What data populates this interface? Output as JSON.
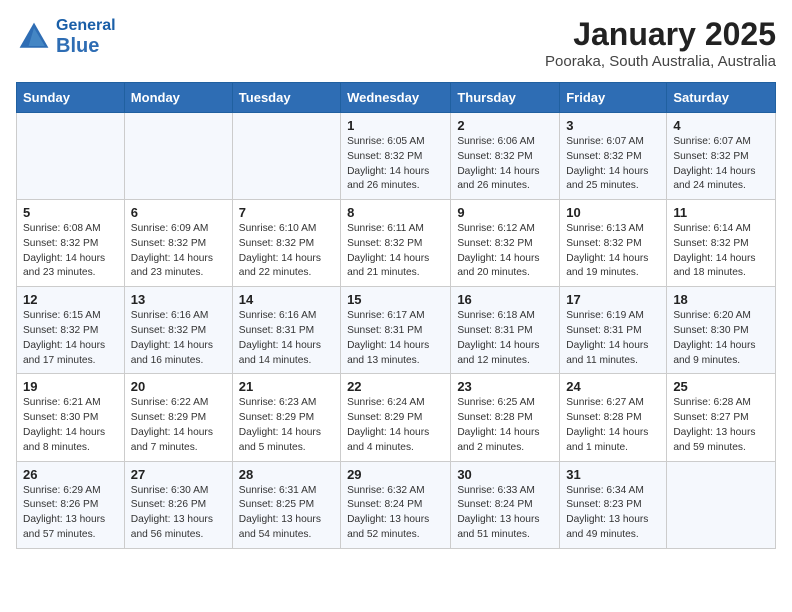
{
  "header": {
    "logo_general": "General",
    "logo_blue": "Blue",
    "title": "January 2025",
    "subtitle": "Pooraka, South Australia, Australia"
  },
  "weekdays": [
    "Sunday",
    "Monday",
    "Tuesday",
    "Wednesday",
    "Thursday",
    "Friday",
    "Saturday"
  ],
  "weeks": [
    [
      {
        "day": "",
        "info": ""
      },
      {
        "day": "",
        "info": ""
      },
      {
        "day": "",
        "info": ""
      },
      {
        "day": "1",
        "info": "Sunrise: 6:05 AM\nSunset: 8:32 PM\nDaylight: 14 hours\nand 26 minutes."
      },
      {
        "day": "2",
        "info": "Sunrise: 6:06 AM\nSunset: 8:32 PM\nDaylight: 14 hours\nand 26 minutes."
      },
      {
        "day": "3",
        "info": "Sunrise: 6:07 AM\nSunset: 8:32 PM\nDaylight: 14 hours\nand 25 minutes."
      },
      {
        "day": "4",
        "info": "Sunrise: 6:07 AM\nSunset: 8:32 PM\nDaylight: 14 hours\nand 24 minutes."
      }
    ],
    [
      {
        "day": "5",
        "info": "Sunrise: 6:08 AM\nSunset: 8:32 PM\nDaylight: 14 hours\nand 23 minutes."
      },
      {
        "day": "6",
        "info": "Sunrise: 6:09 AM\nSunset: 8:32 PM\nDaylight: 14 hours\nand 23 minutes."
      },
      {
        "day": "7",
        "info": "Sunrise: 6:10 AM\nSunset: 8:32 PM\nDaylight: 14 hours\nand 22 minutes."
      },
      {
        "day": "8",
        "info": "Sunrise: 6:11 AM\nSunset: 8:32 PM\nDaylight: 14 hours\nand 21 minutes."
      },
      {
        "day": "9",
        "info": "Sunrise: 6:12 AM\nSunset: 8:32 PM\nDaylight: 14 hours\nand 20 minutes."
      },
      {
        "day": "10",
        "info": "Sunrise: 6:13 AM\nSunset: 8:32 PM\nDaylight: 14 hours\nand 19 minutes."
      },
      {
        "day": "11",
        "info": "Sunrise: 6:14 AM\nSunset: 8:32 PM\nDaylight: 14 hours\nand 18 minutes."
      }
    ],
    [
      {
        "day": "12",
        "info": "Sunrise: 6:15 AM\nSunset: 8:32 PM\nDaylight: 14 hours\nand 17 minutes."
      },
      {
        "day": "13",
        "info": "Sunrise: 6:16 AM\nSunset: 8:32 PM\nDaylight: 14 hours\nand 16 minutes."
      },
      {
        "day": "14",
        "info": "Sunrise: 6:16 AM\nSunset: 8:31 PM\nDaylight: 14 hours\nand 14 minutes."
      },
      {
        "day": "15",
        "info": "Sunrise: 6:17 AM\nSunset: 8:31 PM\nDaylight: 14 hours\nand 13 minutes."
      },
      {
        "day": "16",
        "info": "Sunrise: 6:18 AM\nSunset: 8:31 PM\nDaylight: 14 hours\nand 12 minutes."
      },
      {
        "day": "17",
        "info": "Sunrise: 6:19 AM\nSunset: 8:31 PM\nDaylight: 14 hours\nand 11 minutes."
      },
      {
        "day": "18",
        "info": "Sunrise: 6:20 AM\nSunset: 8:30 PM\nDaylight: 14 hours\nand 9 minutes."
      }
    ],
    [
      {
        "day": "19",
        "info": "Sunrise: 6:21 AM\nSunset: 8:30 PM\nDaylight: 14 hours\nand 8 minutes."
      },
      {
        "day": "20",
        "info": "Sunrise: 6:22 AM\nSunset: 8:29 PM\nDaylight: 14 hours\nand 7 minutes."
      },
      {
        "day": "21",
        "info": "Sunrise: 6:23 AM\nSunset: 8:29 PM\nDaylight: 14 hours\nand 5 minutes."
      },
      {
        "day": "22",
        "info": "Sunrise: 6:24 AM\nSunset: 8:29 PM\nDaylight: 14 hours\nand 4 minutes."
      },
      {
        "day": "23",
        "info": "Sunrise: 6:25 AM\nSunset: 8:28 PM\nDaylight: 14 hours\nand 2 minutes."
      },
      {
        "day": "24",
        "info": "Sunrise: 6:27 AM\nSunset: 8:28 PM\nDaylight: 14 hours\nand 1 minute."
      },
      {
        "day": "25",
        "info": "Sunrise: 6:28 AM\nSunset: 8:27 PM\nDaylight: 13 hours\nand 59 minutes."
      }
    ],
    [
      {
        "day": "26",
        "info": "Sunrise: 6:29 AM\nSunset: 8:26 PM\nDaylight: 13 hours\nand 57 minutes."
      },
      {
        "day": "27",
        "info": "Sunrise: 6:30 AM\nSunset: 8:26 PM\nDaylight: 13 hours\nand 56 minutes."
      },
      {
        "day": "28",
        "info": "Sunrise: 6:31 AM\nSunset: 8:25 PM\nDaylight: 13 hours\nand 54 minutes."
      },
      {
        "day": "29",
        "info": "Sunrise: 6:32 AM\nSunset: 8:24 PM\nDaylight: 13 hours\nand 52 minutes."
      },
      {
        "day": "30",
        "info": "Sunrise: 6:33 AM\nSunset: 8:24 PM\nDaylight: 13 hours\nand 51 minutes."
      },
      {
        "day": "31",
        "info": "Sunrise: 6:34 AM\nSunset: 8:23 PM\nDaylight: 13 hours\nand 49 minutes."
      },
      {
        "day": "",
        "info": ""
      }
    ]
  ]
}
